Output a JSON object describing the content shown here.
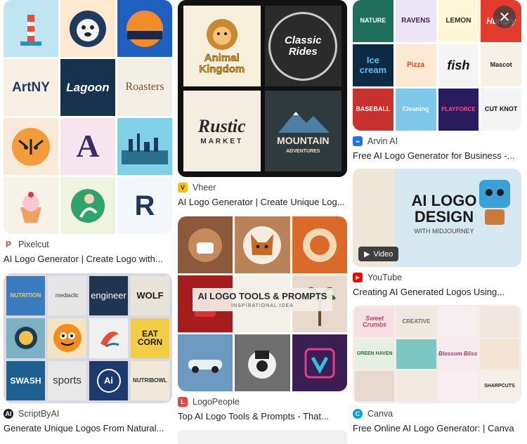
{
  "results": [
    {
      "source": "Pixelcut",
      "title": "AI Logo Generator | Create Logo with...",
      "favicon_color": "#e53935",
      "tiles": [
        "ArtNY",
        "Lagoon",
        "Roasters",
        "A",
        "R"
      ]
    },
    {
      "source": "ScriptByAI",
      "title": "Generate Unique Logos From Natural...",
      "favicon_color": "#202124",
      "tiles": [
        "NUTRITION",
        "mediaclic",
        "engineer",
        "WOLF",
        "SWASH",
        "sports",
        "Ai",
        "NUTRIBOWL",
        "EAT CORN",
        "SWASH"
      ]
    },
    {
      "source": "Vheer",
      "title": "AI Logo Generator | Create Unique Log...",
      "favicon_color": "#f4c20d",
      "tiles": [
        "Animal Kingdom",
        "Classic Rides",
        "Rustic",
        "MARKET",
        "MOUNTAIN",
        "ADVENTURES"
      ]
    },
    {
      "source": "LogoPeople",
      "title": "Top AI Logo Tools & Prompts - That...",
      "favicon_color": "#e8453c",
      "headline": "AI LOGO TOOLS & PROMPTS",
      "subheadline": "INSPIRATIONAL IDEA"
    },
    {
      "source": "Arvin AI",
      "title": "Free AI Logo Generator for Business -...",
      "favicon_color": "#1a73e8",
      "tiles": [
        "NATURE",
        "RAVENS",
        "LEMON",
        "Hungry",
        "Ice cream",
        "Pizza",
        "fish",
        "Mascot",
        "BASEBALL",
        "Cleaning",
        "PLAYFORCE",
        "CUT KNOT"
      ]
    },
    {
      "source": "YouTube",
      "title": "Creating AI Generated Logos Using...",
      "favicon_color": "#ff0000",
      "headline": "AI LOGO DESIGN",
      "subheadline": "WITH MIDJOURNEY",
      "badge": "Video"
    },
    {
      "source": "Canva",
      "title": "Free Online AI Logo Generator: | Canva",
      "favicon_color": "#00a3d9",
      "tiles": [
        "Sweet Crumbs",
        "CREATIVE",
        "GREEN HAVEN",
        "Blossom Bliss",
        "SHARPCUTS"
      ]
    }
  ],
  "close_label": "✕"
}
